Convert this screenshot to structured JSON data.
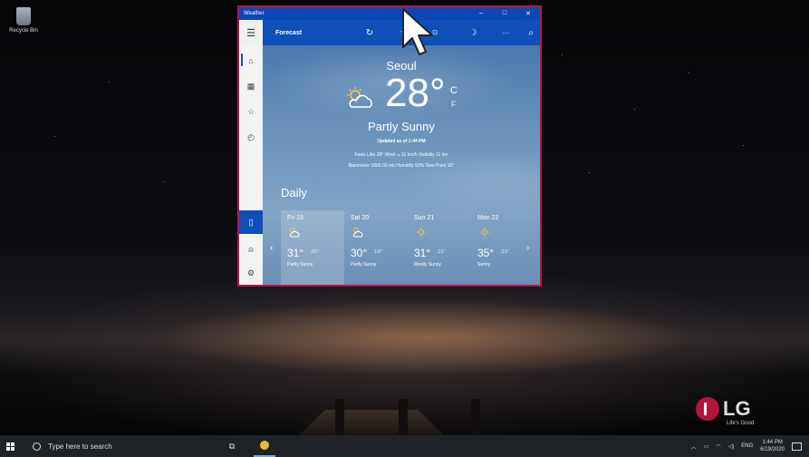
{
  "desktop": {
    "recycle_bin_label": "Recycle Bin",
    "brand": {
      "name": "LG",
      "tagline": "Life's Good"
    }
  },
  "taskbar": {
    "search_placeholder": "Type here to search",
    "tray": {
      "language": "ENG",
      "time": "1:44 PM",
      "date": "6/19/2020"
    }
  },
  "window": {
    "title": "Weather",
    "toolbar": {
      "section": "Forecast"
    },
    "controls": [
      "–",
      "□",
      "✕"
    ]
  },
  "current": {
    "city": "Seoul",
    "temperature": "28°",
    "unit_c": "C",
    "unit_f": "F",
    "condition": "Partly Sunny",
    "updated": "Updated as of 1:44 PM",
    "details_line1": "Feels Like  28°     Wind  ↘ 11 km/h     Visibility  11 km",
    "details_line2": "Barometer  1006.00 mb     Humidity  50%     Dew Point  16°"
  },
  "daily": {
    "heading": "Daily",
    "days": [
      {
        "day": "Fri 19",
        "high": "31°",
        "low": "20°",
        "condition": "Partly Sunny",
        "icon": "partly-sunny"
      },
      {
        "day": "Sat 20",
        "high": "30°",
        "low": "19°",
        "condition": "Partly Sunny",
        "icon": "partly-sunny"
      },
      {
        "day": "Sun 21",
        "high": "31°",
        "low": "21°",
        "condition": "Mostly Sunny",
        "icon": "sunny"
      },
      {
        "day": "Mon 22",
        "high": "35°",
        "low": "23°",
        "condition": "Sunny",
        "icon": "sunny"
      }
    ]
  },
  "colors": {
    "accent": "#0e4fb8",
    "highlight_border": "#c0114a",
    "sun": "#f5d23a"
  }
}
